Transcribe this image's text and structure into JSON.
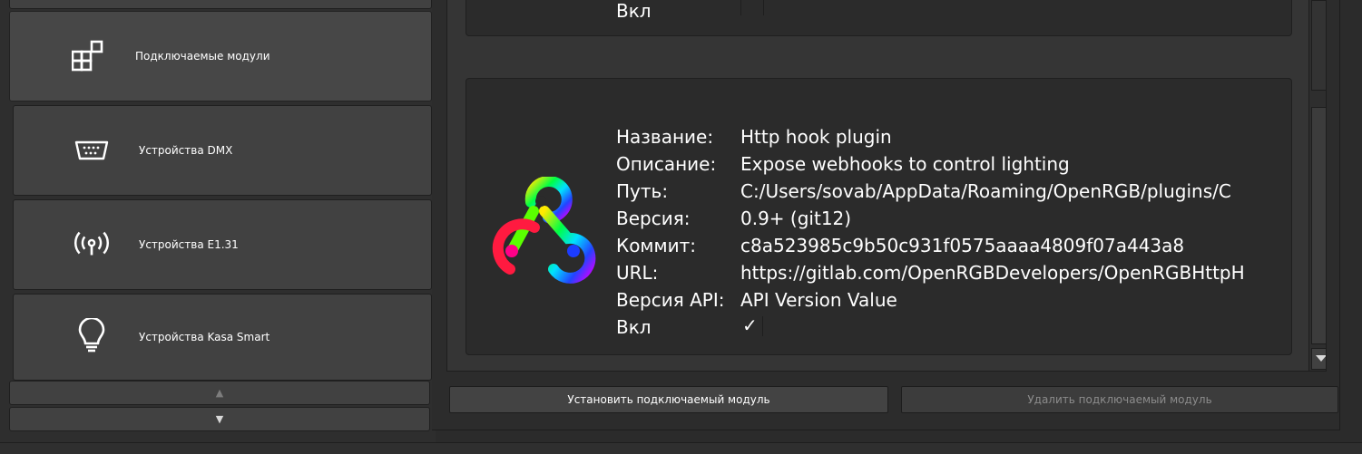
{
  "sidebar": {
    "items": [
      {
        "label": "Подключаемые модули",
        "icon": "plugins-icon",
        "active": true
      },
      {
        "label": "Устройства DMX",
        "icon": "serial-port-icon",
        "active": false
      },
      {
        "label": "Устройства E1.31",
        "icon": "wireless-broadcast-icon",
        "active": false
      },
      {
        "label": "Устройства Kasa Smart",
        "icon": "lightbulb-icon",
        "active": false
      }
    ],
    "scroll_up": "▲",
    "scroll_down": "▼"
  },
  "top_card": {
    "enabled_label": "Вкл"
  },
  "plugin": {
    "name_label": "Название:",
    "name": "Http hook plugin",
    "description_label": "Описание:",
    "description": "Expose webhooks to control lighting",
    "path_label": "Путь:",
    "path": "C:/Users/sovab/AppData/Roaming/OpenRGB/plugins/C",
    "version_label": "Версия:",
    "version": "0.9+ (git12)",
    "commit_label": "Коммит:",
    "commit": "c8a523985c9b50c931f0575aaaa4809f07a443a8",
    "url_label": "URL:",
    "url": "https://gitlab.com/OpenRGBDevelopers/OpenRGBHttpH",
    "api_label": "Версия API:",
    "api": "API Version Value",
    "enabled_label": "Вкл",
    "enabled_mark": "✓",
    "icon": "webhook-icon"
  },
  "buttons": {
    "install": "Установить подключаемый модуль",
    "remove": "Удалить подключаемый модуль"
  },
  "colors": {
    "background": "#2b2b2b",
    "panel": "#414141",
    "text": "#ffffff",
    "disabled_text": "#8c8c8c"
  }
}
